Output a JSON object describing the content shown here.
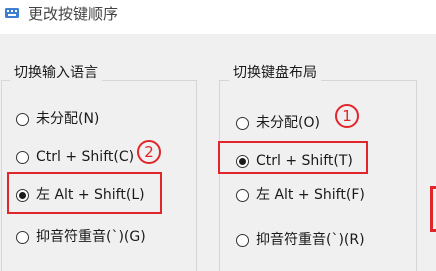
{
  "window": {
    "title": "更改按键顺序"
  },
  "input_language": {
    "legend": "切换输入语言",
    "options": [
      {
        "label": "未分配(N)",
        "checked": false
      },
      {
        "label": "Ctrl + Shift(C)",
        "checked": false
      },
      {
        "label": "左 Alt + Shift(L)",
        "checked": true
      },
      {
        "label": "抑音符重音(`)(G)",
        "checked": false
      }
    ]
  },
  "keyboard_layout": {
    "legend": "切换键盘布局",
    "options": [
      {
        "label": "未分配(O)",
        "checked": false
      },
      {
        "label": "Ctrl + Shift(T)",
        "checked": true
      },
      {
        "label": "左 Alt + Shift(F)",
        "checked": false
      },
      {
        "label": "抑音符重音(`)(R)",
        "checked": false
      }
    ]
  },
  "annotations": {
    "marker_1": "1",
    "marker_2": "2",
    "color": "#e0262a"
  }
}
